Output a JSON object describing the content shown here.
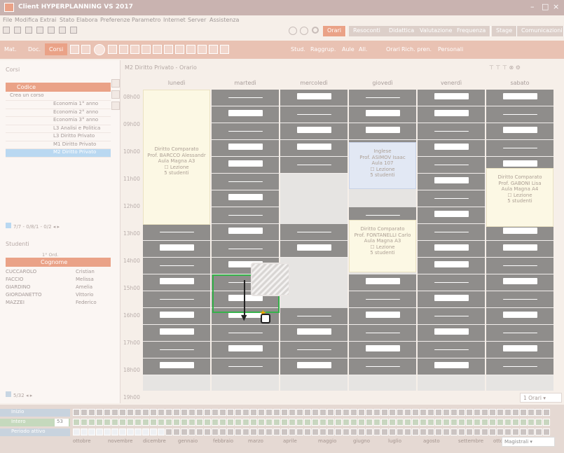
{
  "window": {
    "title": "Client HYPERPLANNING VS 2017",
    "controls": [
      "–",
      "□",
      "×"
    ]
  },
  "menu": [
    "File",
    "Modifica",
    "Extrai",
    "Stato",
    "Elabora",
    "Preferenze",
    "Parametro",
    "Internet",
    "Server",
    "Assistenza"
  ],
  "top_tabs": [
    {
      "label": "Orari",
      "active": true
    },
    {
      "label": "Resoconti",
      "active": false
    },
    {
      "label": "Didattica",
      "active": false
    },
    {
      "label": "Valutazione",
      "active": false
    },
    {
      "label": "Frequenza",
      "active": false
    },
    {
      "label": "Stage",
      "active": false
    },
    {
      "label": "Comunicazioni",
      "active": false
    }
  ],
  "bar2": {
    "left_labels": [
      "Mat.",
      "Doc."
    ],
    "active_tab": "Corsi",
    "right_labels": [
      "Stud.",
      "Raggrup.",
      "Aule",
      "All.",
      "Orari",
      "Rich. pren.",
      "Personali"
    ]
  },
  "left_panel": {
    "title": "Corsi",
    "col_header": "Codice",
    "create_label": "Crea un corso",
    "courses": [
      "Economia 1° anno",
      "Economia 2° anno",
      "Economia 3° anno",
      "L3 Analisi e Politica",
      "L3 Diritto Privato",
      "M1 Diritto Privato",
      "M2 Diritto Privato"
    ],
    "selected_index": 6,
    "pager": "7/7 - 0/8/1 - 0/2",
    "students_title": "Studenti",
    "students_sort": "1° Ord.",
    "students_col": "Cognome",
    "students": [
      {
        "last": "CUCCAROLO",
        "first": "Cristian"
      },
      {
        "last": "FACCIO",
        "first": "Melissa"
      },
      {
        "last": "GIARDINO",
        "first": "Amelia"
      },
      {
        "last": "GIORDANETTO",
        "first": "Vittorio"
      },
      {
        "last": "MAZZEI",
        "first": "Federico"
      }
    ],
    "students_pager": "5/32"
  },
  "schedule": {
    "title": "M2 Diritto Privato - Orario",
    "days": [
      "lunedì",
      "martedì",
      "mercoledì",
      "giovedì",
      "venerdì",
      "sabato"
    ],
    "hours": [
      "08h00",
      "09h00",
      "10h00",
      "11h00",
      "12h00",
      "13h00",
      "14h00",
      "15h00",
      "16h00",
      "17h00",
      "18h00",
      "19h00"
    ],
    "lessons": [
      {
        "lines": [
          "Diritto Comparato",
          "Prof. BARCCO Alessandr",
          "Aula Magna A3",
          "☐ Lezione",
          "5 studenti"
        ]
      },
      {
        "lines": [
          "Inglese",
          "Prof. ASIMOV Isaac",
          "Aula 107",
          "☐ Lezione",
          "5 studenti"
        ]
      },
      {
        "lines": [
          "Diritto Comparato",
          "Prof. GABONI Lisa",
          "Aula Magna A4",
          "☐ Lezione",
          "5 studenti"
        ]
      },
      {
        "lines": [
          "Diritto Comparato",
          "Prof. FONTANELLI Carlo",
          "Aula Magna A3",
          "☐ Lezione",
          "5 studenti"
        ]
      }
    ],
    "view_select": "1 Orari"
  },
  "footer": {
    "rows": [
      "Inizio",
      "Intero",
      "Periodo attivo"
    ],
    "week_value": "53",
    "months": [
      "ottobre",
      "novembre",
      "dicembre",
      "gennaio",
      "febbraio",
      "marzo",
      "aprile",
      "maggio",
      "giugno",
      "luglio",
      "agosto",
      "settembre",
      "otto"
    ],
    "period_select": "Magistrali"
  },
  "colors": {
    "accent": "#eaa287",
    "slot_gray": "#8f8d8b",
    "drag_border": "#35b24a",
    "selected_row": "#b9d8f1"
  }
}
